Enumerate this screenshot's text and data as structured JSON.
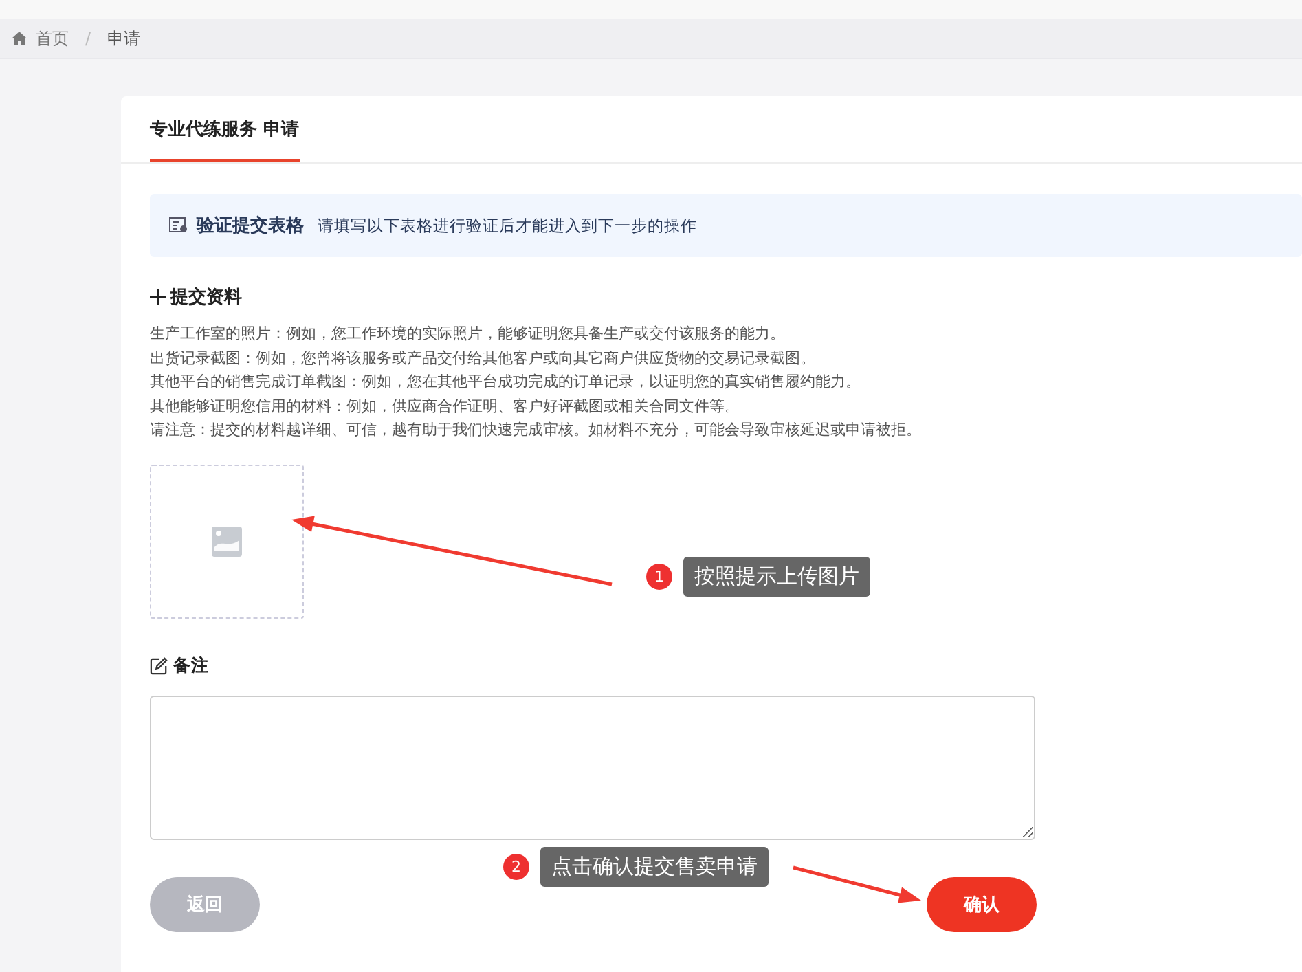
{
  "breadcrumb_separator": "/",
  "breadcrumb": [
    {
      "label": "首页",
      "selected": false
    },
    {
      "label": "申请",
      "selected": true
    }
  ],
  "tab": {
    "label": "专业代练服务 申请",
    "selected": true
  },
  "alert": {
    "title": "验证提交表格",
    "message": "请填写以下表格进行验证后才能进入到下一步的操作"
  },
  "section": {
    "title": "提交资料",
    "lines": [
      "生产工作室的照片：例如，您工作环境的实际照片，能够证明您具备生产或交付该服务的能力。",
      "出货记录截图：例如，您曾将该服务或产品交付给其他客户或向其它商户供应货物的交易记录截图。",
      "其他平台的销售完成订单截图：例如，您在其他平台成功完成的订单记录，以证明您的真实销售履约能力。",
      "其他能够证明您信用的材料：例如，供应商合作证明、客户好评截图或相关合同文件等。",
      "请注意：提交的材料越详细、可信，越有助于我们快速完成审核。如材料不充分，可能会导致审核延迟或申请被拒。"
    ]
  },
  "remark": {
    "label": "备注"
  },
  "buttons": [
    {
      "label": "返回",
      "kind": "secondary"
    },
    {
      "label": "确认",
      "kind": "primary"
    }
  ],
  "annotations": [
    {
      "number": "1",
      "text": "按照提示上传图片"
    },
    {
      "number": "2",
      "text": "点击确认提交售卖申请"
    }
  ]
}
